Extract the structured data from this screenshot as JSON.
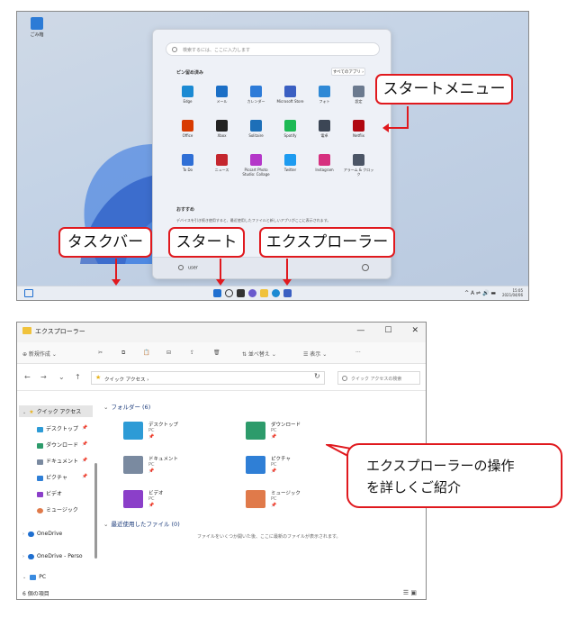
{
  "desktop": {
    "desktop_icon_label": "ごみ箱",
    "start_menu": {
      "search_placeholder": "検索するには、ここに入力します",
      "pinned_title": "ピン留め済み",
      "all_apps_label": "すべてのアプリ ›",
      "apps": [
        {
          "name": "Edge",
          "color": "#1b8ad3"
        },
        {
          "name": "メール",
          "color": "#1b6fc6"
        },
        {
          "name": "カレンダー",
          "color": "#2d7bd8"
        },
        {
          "name": "Microsoft Store",
          "color": "#3a5fc2"
        },
        {
          "name": "フォト",
          "color": "#2f89d6"
        },
        {
          "name": "設定",
          "color": "#6b7a8f"
        },
        {
          "name": "Office",
          "color": "#d83b01"
        },
        {
          "name": "Xbox",
          "color": "#222222"
        },
        {
          "name": "Solitaire",
          "color": "#1d6fb8"
        },
        {
          "name": "Spotify",
          "color": "#1db954"
        },
        {
          "name": "電卓",
          "color": "#3c4655"
        },
        {
          "name": "Netflix",
          "color": "#b00710"
        },
        {
          "name": "To Do",
          "color": "#2f6fd6"
        },
        {
          "name": "ニュース",
          "color": "#c4262e"
        },
        {
          "name": "Picsart Photo Studio: Collage",
          "color": "#b437c9"
        },
        {
          "name": "Twitter",
          "color": "#1d9bf0"
        },
        {
          "name": "Instagram",
          "color": "#d6307f"
        },
        {
          "name": "アラーム & クロック",
          "color": "#4b5566"
        }
      ],
      "recommended_title": "おすすめ",
      "recommended_text": "デバイスを引き続き使用すると、最近使用したファイルと新しいアプリがここに表示されます。",
      "user_name": "user"
    },
    "taskbar": {
      "tray": "^ A ⇌ 🔊 ▬",
      "time": "15:05",
      "date": "2021/04/06"
    },
    "callouts": {
      "start_menu": "スタートメニュー",
      "taskbar": "タスクバー",
      "start": "スタート",
      "explorer": "エクスプローラー"
    }
  },
  "explorer": {
    "window_title": "エクスプローラー",
    "window_controls": {
      "minimize": "—",
      "maximize": "☐",
      "close": "✕"
    },
    "commands": {
      "new": "⊕ 新規作成 ⌄",
      "cut": "✂",
      "copy": "⧉",
      "paste": "📋",
      "rename": "⊟",
      "share": "⇪",
      "delete": "🗑",
      "sort": "⇅ 並べ替え ⌄",
      "view": "☰ 表示 ⌄",
      "more": "···"
    },
    "nav": {
      "back": "←",
      "forward": "→",
      "recent": "⌄",
      "up": "↑",
      "refresh": "↻"
    },
    "address": "クイック アクセス ›",
    "search_placeholder": "クイック アクセスの検索",
    "sidebar": {
      "quick_access": "クイック アクセス",
      "items": [
        "デスクトップ",
        "ダウンロード",
        "ドキュメント",
        "ピクチャ",
        "ビデオ",
        "ミュージック"
      ],
      "onedrive": "OneDrive",
      "onedrive_personal": "OneDrive - Perso",
      "pc": "PC"
    },
    "folders_header": "フォルダー (6)",
    "folders": [
      {
        "name": "デスクトップ",
        "location": "PC",
        "color": "#2d9bd6"
      },
      {
        "name": "ダウンロード",
        "location": "PC",
        "color": "#2d9b6b"
      },
      {
        "name": "ドキュメント",
        "location": "PC",
        "color": "#7a8aa0"
      },
      {
        "name": "ピクチャ",
        "location": "PC",
        "color": "#2f7fd6"
      },
      {
        "name": "ビデオ",
        "location": "PC",
        "color": "#8b3fc9"
      },
      {
        "name": "ミュージック",
        "location": "PC",
        "color": "#e07a4a"
      }
    ],
    "recent_header": "最近使用したファイル (0)",
    "recent_empty": "ファイルをいくつか開いた後、ここに最新のファイルが表示されます。",
    "status": "6 個の項目",
    "bubble_line1": "エクスプローラーの操作",
    "bubble_line2": "を詳しくご紹介"
  }
}
